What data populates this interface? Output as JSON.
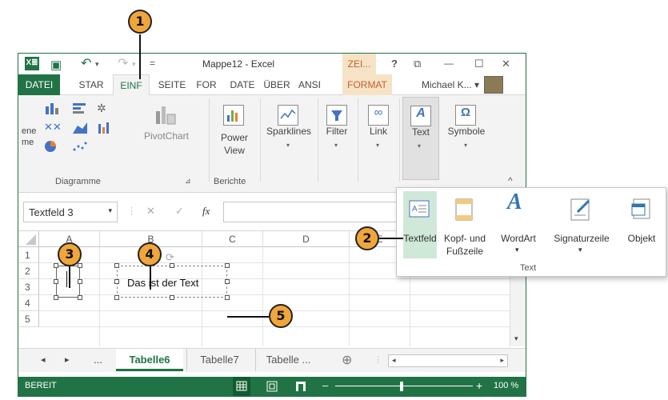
{
  "title": {
    "doc_title": "Mappe12 - Excel",
    "context": "ZEI...",
    "help": "?",
    "excel_logo": "X≣",
    "save_glyph": "▣",
    "undo_glyph": "↶",
    "redo_glyph": "↷",
    "qat_glyph": "=",
    "restore_glyph": "⧉",
    "min_glyph": "—",
    "max_glyph": "☐",
    "close_glyph": "✕"
  },
  "tabs": [
    "DATEI",
    "STAR",
    "EINF",
    "SEITE",
    "FOR",
    "DATE",
    "ÜBER",
    "ANSI",
    "FORMAT"
  ],
  "user": "Michael K...",
  "ribbon": {
    "diagrams_group": "Diagramme",
    "partial_left_1": "ene",
    "partial_left_2": "me",
    "pivotchart": "PivotChart",
    "power_view": "Power View",
    "power_line1": "Power",
    "power_line2": "View",
    "reports_group": "Berichte",
    "sparklines": "Sparklines",
    "filter": "Filter",
    "link": "Link",
    "text": "Text",
    "symbols": "Symbole",
    "collapse": "^",
    "text_glyph": "A",
    "omega_glyph": "Ω"
  },
  "formula": {
    "name_box": "Textfeld 3",
    "cancel_glyph": "✕",
    "enter_glyph": "✓",
    "fx_glyph": "fx"
  },
  "grid": {
    "columns": [
      "A",
      "B",
      "C",
      "D",
      "E"
    ],
    "rows": [
      "1",
      "2",
      "3",
      "4",
      "5"
    ],
    "textbox_text": "Das ist der Text"
  },
  "sheets": {
    "tabs": [
      "Tabelle6",
      "Tabelle7",
      "Tabelle ..."
    ],
    "ellipsis": "...",
    "prev_glyph": "◂",
    "next_glyph": "▸",
    "add_glyph": "⊕"
  },
  "status": {
    "ready": "BEREIT",
    "zoom": "100 %"
  },
  "popup": {
    "items": [
      {
        "line1": "Textfeld",
        "line2": ""
      },
      {
        "line1": "Kopf- und",
        "line2": "Fußzeile"
      },
      {
        "line1": "WordArt",
        "line2": ""
      },
      {
        "line1": "Signaturzeile",
        "line2": ""
      },
      {
        "line1": "Objekt",
        "line2": ""
      }
    ],
    "group_label": "Text"
  },
  "callouts": [
    "1",
    "2",
    "3",
    "4",
    "5"
  ],
  "colors": {
    "excel_green": "#217346",
    "callout_orange": "#f0a63a",
    "context_orange": "#c7602a"
  }
}
